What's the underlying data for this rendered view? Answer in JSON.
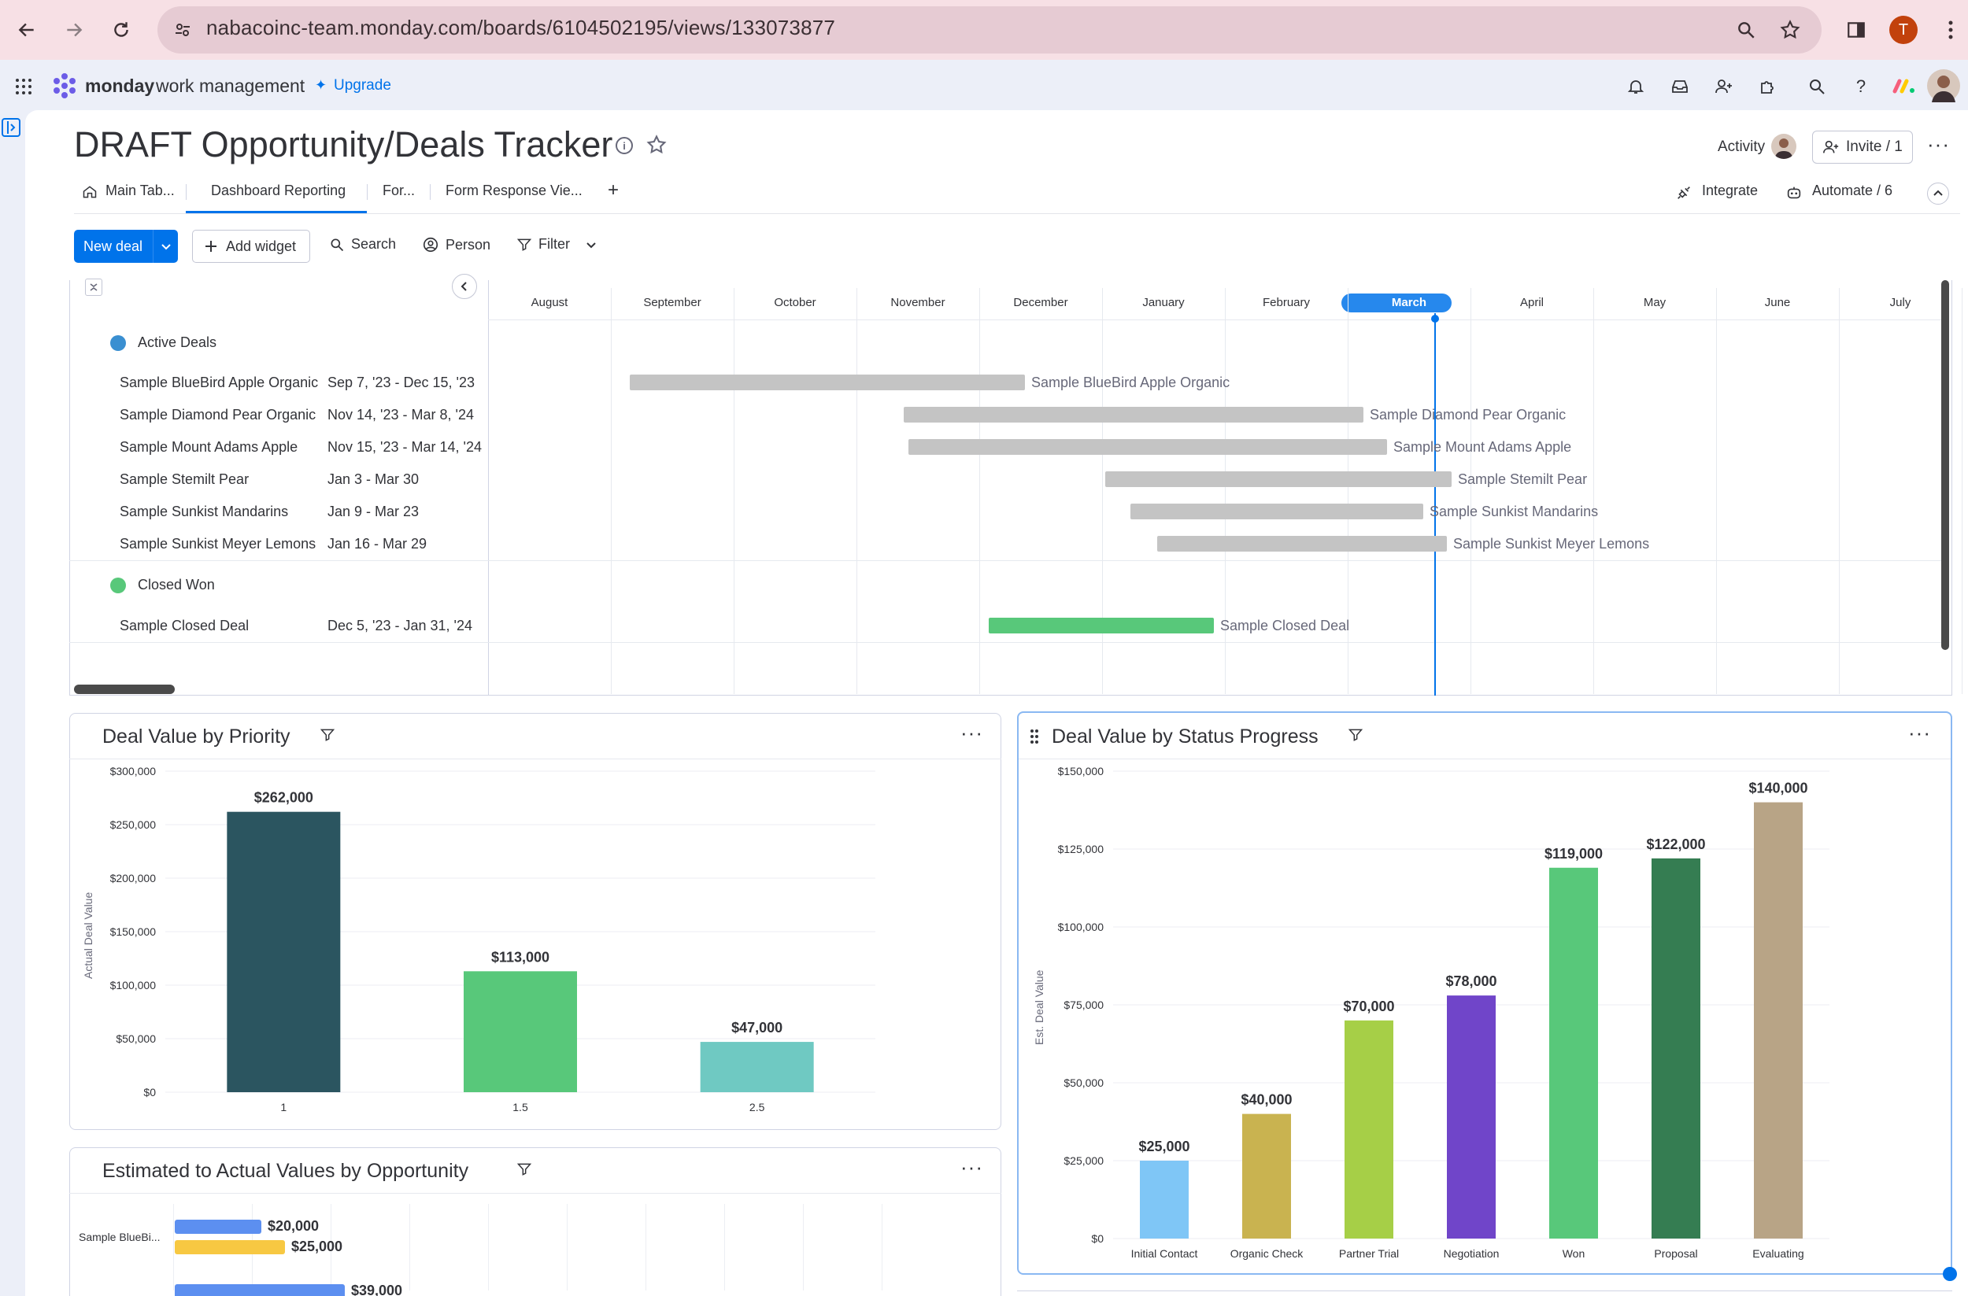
{
  "browser": {
    "url": "nabacoinc-team.monday.com/boards/6104502195/views/133073877",
    "profile_initial": "T"
  },
  "app": {
    "brand": "monday",
    "brand_sub": "work management",
    "upgrade": "Upgrade"
  },
  "board": {
    "title": "DRAFT Opportunity/Deals Tracker",
    "activity": "Activity",
    "invite": "Invite / 1",
    "tabs": [
      {
        "label": "Main Tab..."
      },
      {
        "label": "Dashboard Reporting"
      },
      {
        "label": "For..."
      },
      {
        "label": "Form Response Vie..."
      }
    ],
    "add_tab": "+",
    "integrate": "Integrate",
    "automate": "Automate / 6"
  },
  "toolbar": {
    "new_deal": "New deal",
    "add_widget": "Add widget",
    "search": "Search",
    "person": "Person",
    "filter": "Filter"
  },
  "gantt": {
    "months": [
      "August",
      "September",
      "October",
      "November",
      "December",
      "January",
      "February",
      "March",
      "April",
      "May",
      "June",
      "July"
    ],
    "current_month": "March",
    "groups": [
      {
        "name": "Active Deals",
        "color": "#3a8fd1",
        "items": [
          {
            "name": "Sample BlueBird Apple Organic",
            "range": "Sep 7, '23 - Dec 15, '23"
          },
          {
            "name": "Sample Diamond Pear Organic",
            "range": "Nov 14, '23 - Mar 8, '24"
          },
          {
            "name": "Sample Mount Adams Apple",
            "range": "Nov 15, '23 - Mar 14, '24"
          },
          {
            "name": "Sample Stemilt Pear",
            "range": "Jan 3 - Mar 30"
          },
          {
            "name": "Sample Sunkist Mandarins",
            "range": "Jan 9 - Mar 23"
          },
          {
            "name": "Sample Sunkist Meyer Lemons",
            "range": "Jan 16 - Mar 29"
          }
        ]
      },
      {
        "name": "Closed Won",
        "color": "#58c87a",
        "items": [
          {
            "name": "Sample Closed Deal",
            "range": "Dec 5, '23 - Jan 31, '24"
          }
        ]
      }
    ]
  },
  "chart_priority": {
    "title": "Deal Value by Priority",
    "chart_data": {
      "type": "bar",
      "categories": [
        "1",
        "1.5",
        "2.5"
      ],
      "values": [
        262000,
        113000,
        47000
      ],
      "value_labels": [
        "$262,000",
        "$113,000",
        "$47,000"
      ],
      "colors": [
        "#2b5560",
        "#58c87a",
        "#6fc9c2"
      ],
      "ylabel": "Actual Deal Value",
      "yticks": [
        "$0",
        "$50,000",
        "$100,000",
        "$150,000",
        "$200,000",
        "$250,000",
        "$300,000"
      ],
      "ylim": [
        0,
        300000
      ]
    }
  },
  "chart_status": {
    "title": "Deal Value by Status Progress",
    "chart_data": {
      "type": "bar",
      "categories": [
        "Initial Contact",
        "Organic Check",
        "Partner Trial",
        "Negotiation",
        "Won",
        "Proposal",
        "Evaluating"
      ],
      "values": [
        25000,
        40000,
        70000,
        78000,
        119000,
        122000,
        140000
      ],
      "value_labels": [
        "$25,000",
        "$40,000",
        "$70,000",
        "$78,000",
        "$119,000",
        "$122,000",
        "$140,000"
      ],
      "colors": [
        "#7fc6f6",
        "#c9b350",
        "#a6cf47",
        "#7045c9",
        "#58c87a",
        "#357d52",
        "#b8a486"
      ],
      "ylabel": "Est. Deal Value",
      "yticks": [
        "$0",
        "$25,000",
        "$50,000",
        "$75,000",
        "$100,000",
        "$125,000",
        "$150,000"
      ],
      "ylim": [
        0,
        150000
      ]
    }
  },
  "chart_est": {
    "title": "Estimated to Actual Values by Opportunity",
    "chart_data": {
      "type": "bar",
      "categories": [
        "Sample BlueBi..."
      ],
      "series": [
        {
          "values": [
            20000
          ],
          "color": "#5c8ff0"
        },
        {
          "values": [
            25000
          ],
          "color": "#f7c842"
        }
      ],
      "value_labels": [
        "$20,000",
        "$25,000",
        "$39,000"
      ]
    }
  }
}
